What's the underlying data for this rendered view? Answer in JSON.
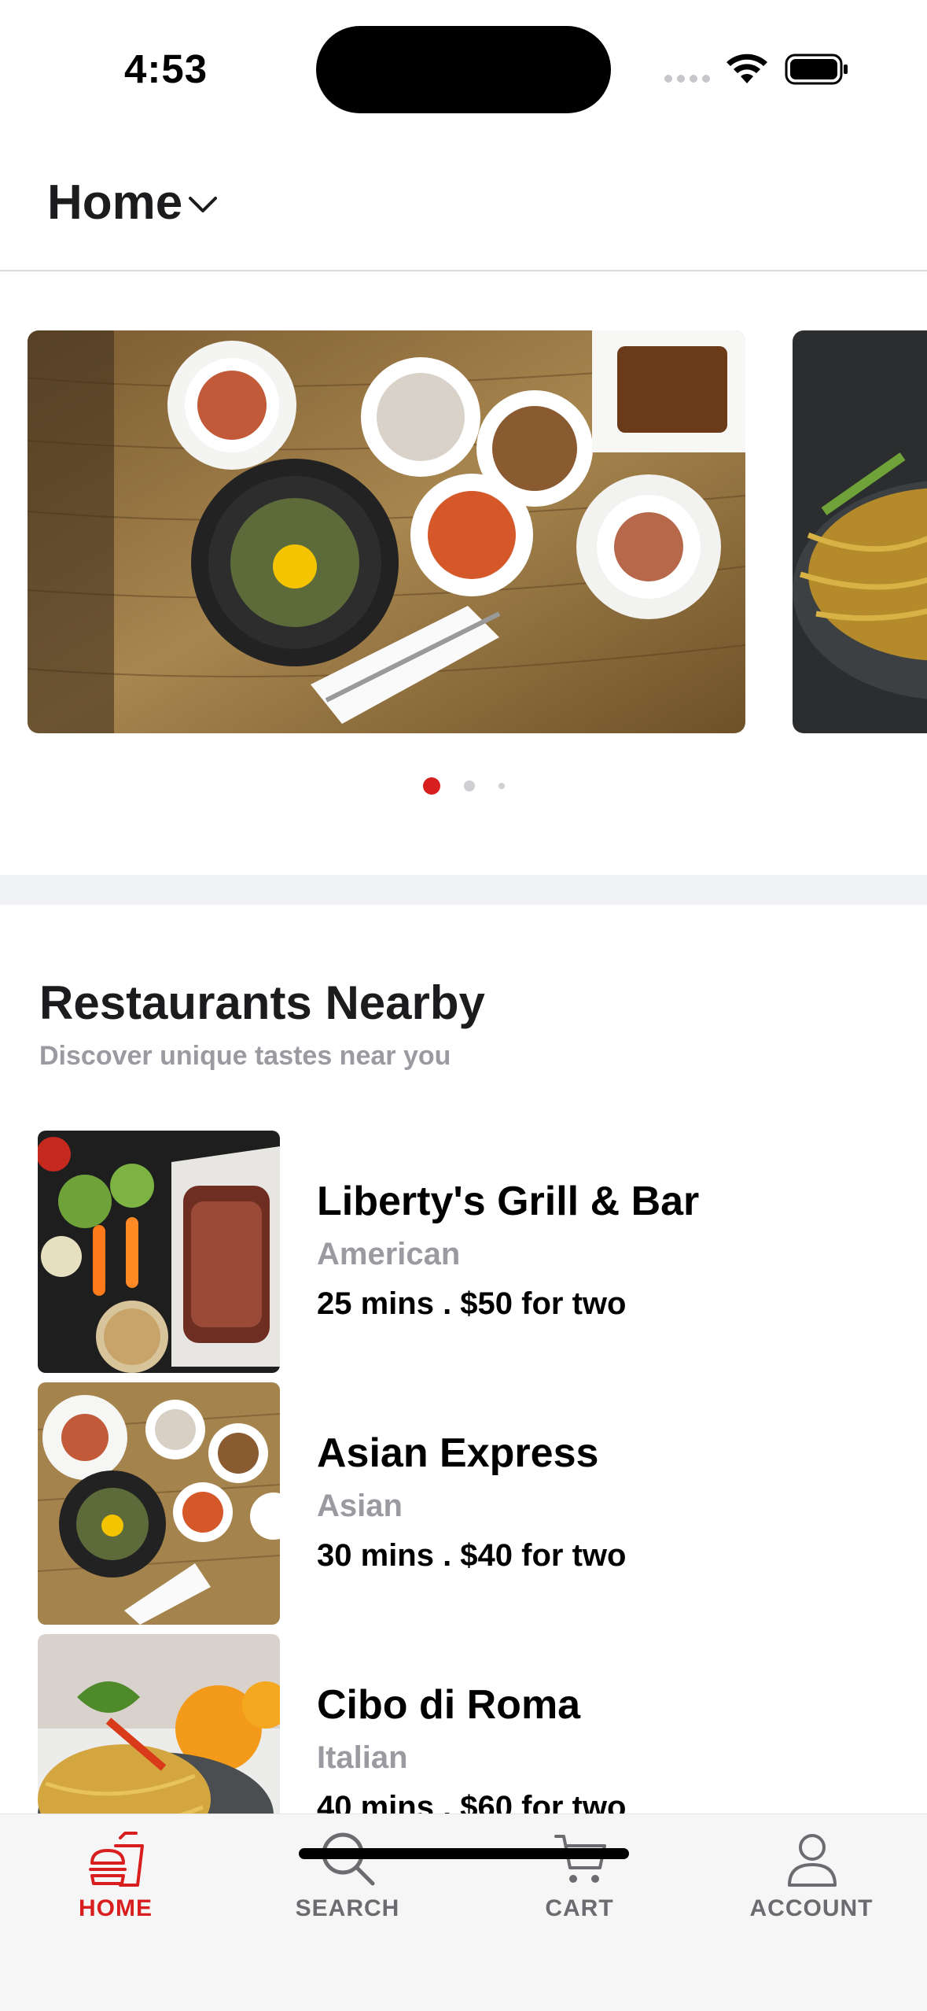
{
  "status_bar": {
    "time": "4:53"
  },
  "header": {
    "title": "Home"
  },
  "carousel": {
    "active_index": 0,
    "total": 3
  },
  "section": {
    "title": "Restaurants Nearby",
    "subtitle": "Discover unique tastes near you"
  },
  "restaurants": [
    {
      "name": "Liberty's Grill & Bar",
      "cuisine": "American",
      "meta": "25 mins . $50 for two"
    },
    {
      "name": "Asian Express",
      "cuisine": "Asian",
      "meta": "30 mins . $40 for two"
    },
    {
      "name": "Cibo di Roma",
      "cuisine": "Italian",
      "meta": "40 mins . $60 for two"
    }
  ],
  "tabs": [
    {
      "label": "HOME",
      "icon": "burger-icon",
      "active": true
    },
    {
      "label": "SEARCH",
      "icon": "search-icon",
      "active": false
    },
    {
      "label": "CART",
      "icon": "cart-icon",
      "active": false
    },
    {
      "label": "ACCOUNT",
      "icon": "person-icon",
      "active": false
    }
  ],
  "colors": {
    "accent": "#d81e1e",
    "muted": "#9a9aa0",
    "divider": "#f1f2f6"
  }
}
